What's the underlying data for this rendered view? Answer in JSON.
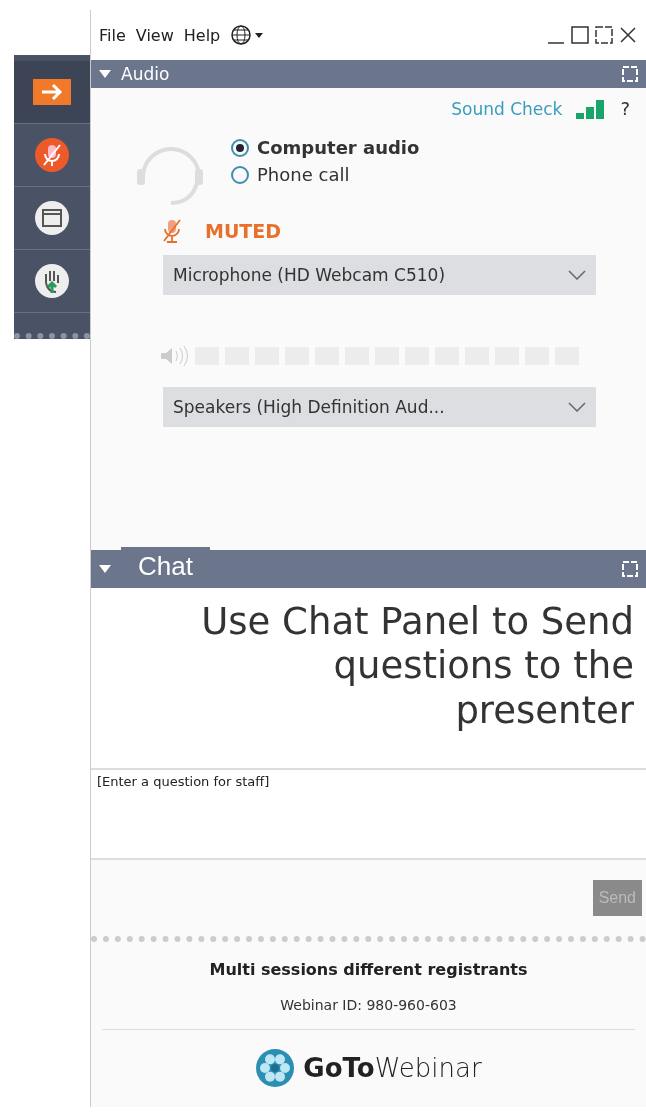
{
  "menu": [
    "File",
    "View",
    "Help"
  ],
  "sidebar": [
    {
      "kind": "arrow",
      "selected": true
    },
    {
      "kind": "mic",
      "selected": false
    },
    {
      "kind": "screen",
      "selected": false
    },
    {
      "kind": "hand",
      "selected": false
    }
  ],
  "audio": {
    "title": "Audio",
    "expanded": true,
    "sound_check": "Sound Check",
    "help": "?",
    "options": [
      {
        "label": "Computer audio",
        "selected": true
      },
      {
        "label": "Phone call",
        "selected": false
      }
    ],
    "mute_status": "MUTED",
    "microphone": "Microphone (HD Webcam C510)",
    "speakers": "Speakers (High Definition Aud..."
  },
  "chat": {
    "title": "Chat",
    "expanded": true,
    "message": "Use Chat Panel to Send questions to the presenter",
    "placeholder": "[Enter a question for staff]",
    "send": "Send",
    "send_disabled": true
  },
  "footer": {
    "title": "Multi sessions different registrants",
    "webinar_id": "Webinar ID: 980-960-603",
    "logo": "**GoTo**Webinar"
  }
}
